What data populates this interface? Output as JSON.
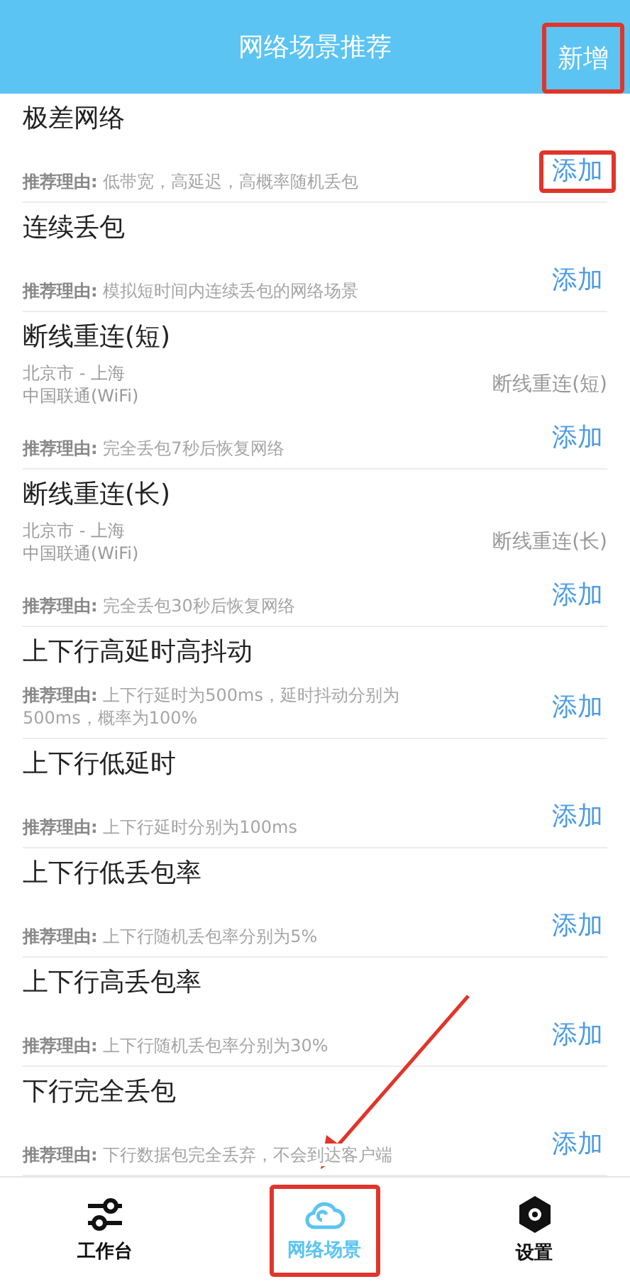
{
  "header": {
    "title": "网络场景推荐",
    "action": {
      "label": "新增",
      "highlighted": true
    }
  },
  "scenes": [
    {
      "title": "极差网络",
      "reason": "**推荐理由:** 低带宽，高延迟，高概率随机丢包",
      "add": {
        "label": "添加",
        "highlighted": true
      }
    },
    {
      "title": "连续丢包",
      "reason": "**推荐理由:** 模拟短时间内连续丢包的网络场景",
      "add": {
        "label": "添加",
        "highlighted": false
      }
    },
    {
      "title": "断线重连(短)",
      "route": "北京市 - 上海",
      "carrier": "中国联通(WiFi)",
      "tag": "断线重连(短)",
      "reason": "**推荐理由:** 完全丢包7秒后恢复网络",
      "add": {
        "label": "添加",
        "highlighted": false
      }
    },
    {
      "title": "断线重连(长)",
      "route": "北京市 - 上海",
      "carrier": "中国联通(WiFi)",
      "tag": "断线重连(长)",
      "reason": "**推荐理由:** 完全丢包30秒后恢复网络",
      "add": {
        "label": "添加",
        "highlighted": false
      }
    },
    {
      "title": "上下行高延时高抖动",
      "reason": "**推荐理由:** 上下行延时为500ms，延时抖动分别为500ms，概率为100%",
      "add": {
        "label": "添加",
        "highlighted": false
      }
    },
    {
      "title": "上下行低延时",
      "reason": "**推荐理由:** 上下行延时分别为100ms",
      "add": {
        "label": "添加",
        "highlighted": false
      }
    },
    {
      "title": "上下行低丢包率",
      "reason": "**推荐理由:** 上下行随机丢包率分别为5%",
      "add": {
        "label": "添加",
        "highlighted": false
      }
    },
    {
      "title": "上下行高丢包率",
      "reason": "**推荐理由:** 上下行随机丢包率分别为30%",
      "add": {
        "label": "添加",
        "highlighted": false
      }
    },
    {
      "title": "下行完全丢包",
      "reason": "**推荐理由:** 下行数据包完全丢弃，不会到达客户端",
      "add": {
        "label": "添加",
        "highlighted": false
      }
    }
  ],
  "tabs": [
    {
      "kind": "sliders",
      "label": "工作台",
      "selected": false,
      "highlighted": false
    },
    {
      "kind": "cloud",
      "label": "网络场景",
      "selected": true,
      "highlighted": true
    },
    {
      "kind": "hexagon",
      "label": "设置",
      "selected": false,
      "highlighted": false
    }
  ]
}
